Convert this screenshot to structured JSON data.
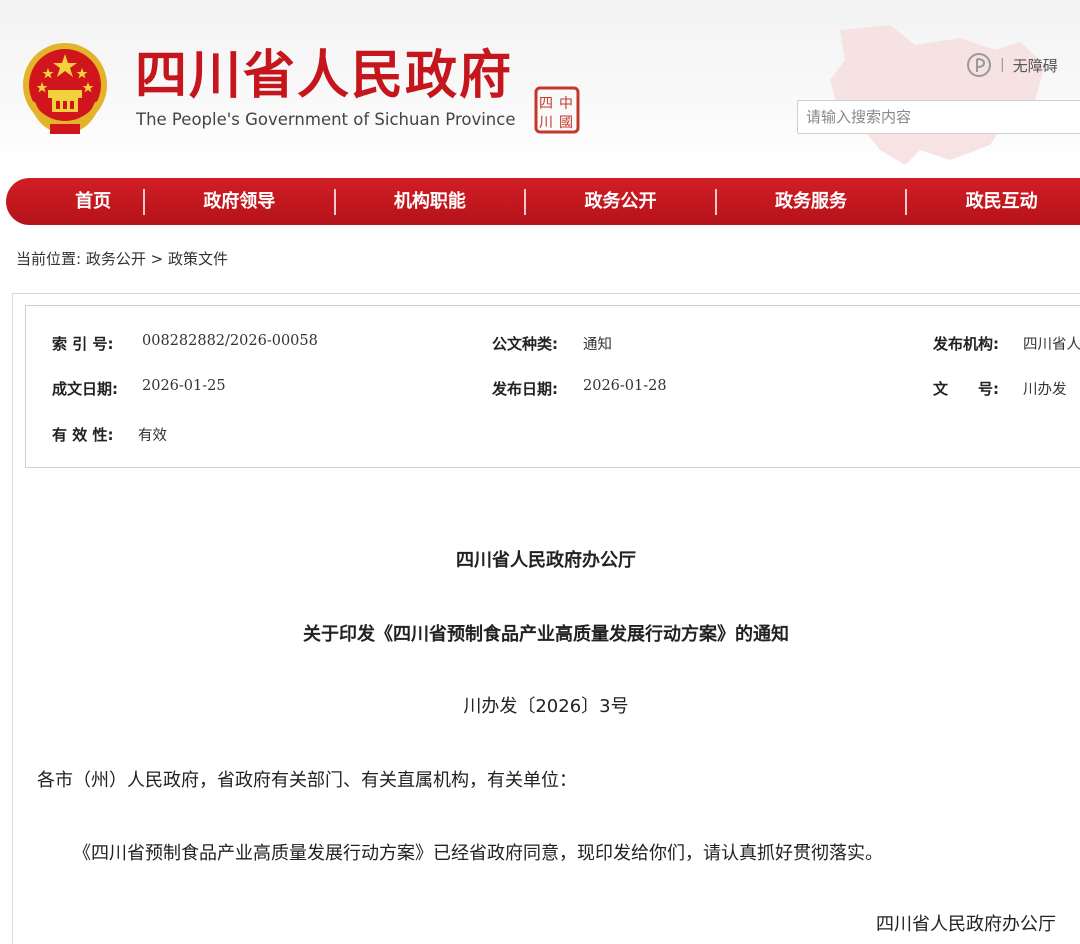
{
  "header": {
    "site_title": "四川省人民政府",
    "site_subtitle": "The People's Government of Sichuan Province",
    "seal_text": "四川中国",
    "accessibility_label": "无障碍",
    "separator": "|",
    "search_placeholder": "请输入搜索内容"
  },
  "nav": {
    "items": [
      {
        "label": "首页"
      },
      {
        "label": "政府领导"
      },
      {
        "label": "机构职能"
      },
      {
        "label": "政务公开"
      },
      {
        "label": "政务服务"
      },
      {
        "label": "政民互动"
      }
    ]
  },
  "breadcrumb": {
    "prefix": "当前位置:",
    "items": [
      "政务公开",
      "政策文件"
    ],
    "separator": ">"
  },
  "meta": {
    "index_label": "索 引 号:",
    "index_value": "008282882/2026-00058",
    "doc_type_label": "公文种类:",
    "doc_type_value": "通知",
    "publisher_label": "发布机构:",
    "publisher_value": "四川省人",
    "written_date_label": "成文日期:",
    "written_date_value": "2026-01-25",
    "publish_date_label": "发布日期:",
    "publish_date_value": "2026-01-28",
    "doc_number_label": "文　　号:",
    "doc_number_value": "川办发",
    "validity_label": "有 效 性:",
    "validity_value": "有效"
  },
  "document": {
    "issuer": "四川省人民政府办公厅",
    "title": "关于印发《四川省预制食品产业高质量发展行动方案》的通知",
    "number": "川办发〔2026〕3号",
    "salutation": "各市（州）人民政府，省政府有关部门、有关直属机构，有关单位：",
    "body": "《四川省预制食品产业高质量发展行动方案》已经省政府同意，现印发给你们，请认真抓好贯彻落实。",
    "signature": "四川省人民政府办公厅"
  },
  "colors": {
    "brand_red": "#c4161c",
    "nav_red": "#c8171f",
    "seal_red": "#c0392b"
  }
}
